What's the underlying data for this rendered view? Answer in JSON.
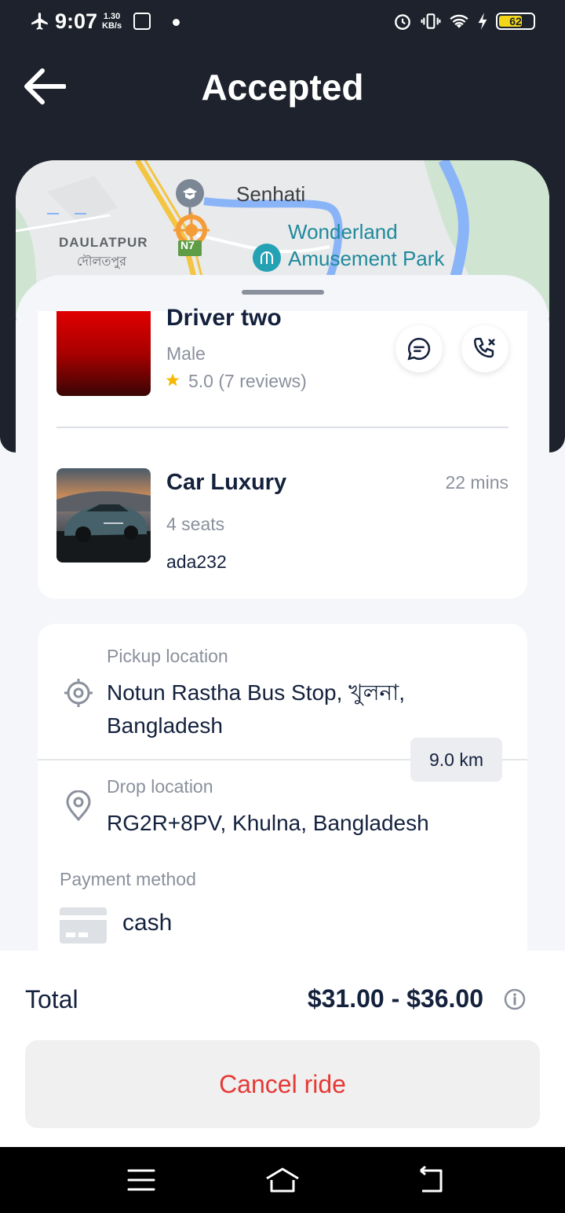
{
  "status_bar": {
    "time": "9:07",
    "speed_value": "1.30",
    "speed_unit": "KB/s",
    "battery": "62"
  },
  "header": {
    "title": "Accepted"
  },
  "map": {
    "labels": {
      "senhati": "Senhati",
      "daulatpur_en": "DAULATPUR",
      "daulatpur_bn": "দৌলতপুর",
      "wonderland_1": "Wonderland",
      "wonderland_2": "Amusement Park",
      "road_badge": "N7"
    }
  },
  "driver": {
    "name": "Driver two",
    "gender": "Male",
    "rating": "5.0",
    "reviews": "(7 reviews)"
  },
  "car": {
    "name": "Car Luxury",
    "eta": "22 mins",
    "seats": "4 seats",
    "plate": "ada232"
  },
  "trip": {
    "pickup_label": "Pickup location",
    "pickup_value": "Notun Rastha Bus Stop, খুলনা, Bangladesh",
    "distance": "9.0 km",
    "drop_label": "Drop location",
    "drop_value": "RG2R+8PV, Khulna, Bangladesh",
    "payment_label": "Payment method",
    "payment_value": "cash"
  },
  "footer": {
    "total_label": "Total",
    "total_value": "$31.00 - $36.00",
    "cancel_label": "Cancel ride"
  },
  "colors": {
    "header_bg": "#1d222c",
    "accent_text": "#14213d",
    "muted_text": "#8a909c",
    "danger": "#e53935",
    "star": "#f5b800"
  }
}
